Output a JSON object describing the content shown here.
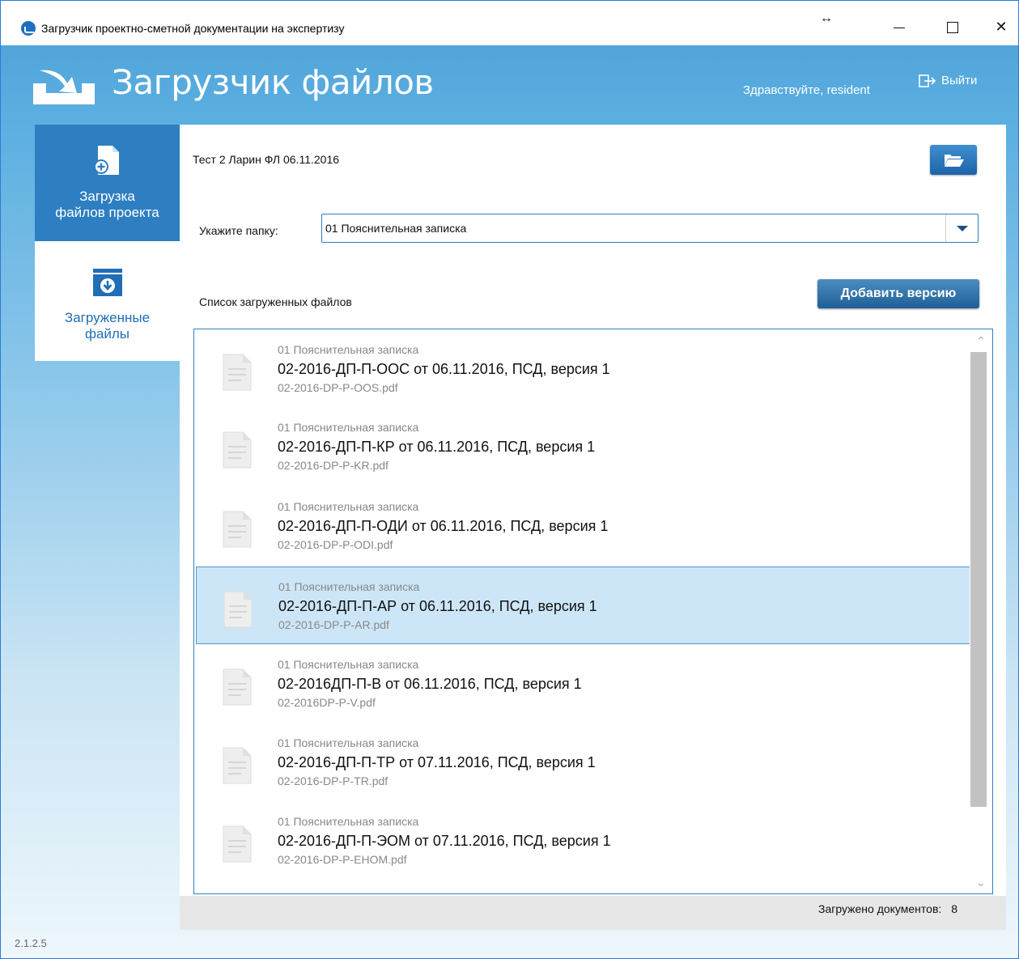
{
  "window": {
    "title": "Загрузчик проектно-сметной документации на экспертизу",
    "resize_glyph": "↔",
    "close_glyph": "✕"
  },
  "header": {
    "app_title": "Загрузчик файлов",
    "greeting": "Здравствуйте, resident",
    "logout_label": "Выйти"
  },
  "sidebar": {
    "items": [
      {
        "label": "Загрузка\nфайлов проекта",
        "icon": "file-add-icon",
        "active": true
      },
      {
        "label": "Загруженные\nфайлы",
        "icon": "folder-download-icon",
        "active": false
      }
    ]
  },
  "main": {
    "project_name": "Тест 2 Ларин ФЛ 06.11.2016",
    "folder_label": "Укажите папку:",
    "folder_selected": "01 Пояснительная записка",
    "list_title": "Список загруженных файлов",
    "add_version_label": "Добавить версию",
    "files": [
      {
        "folder": "01 Пояснительная записка",
        "title": "02-2016-ДП-П-ООС от 06.11.2016, ПСД, версия 1",
        "file": "02-2016-DP-P-OOS.pdf"
      },
      {
        "folder": "01 Пояснительная записка",
        "title": "02-2016-ДП-П-КР от 06.11.2016, ПСД, версия 1",
        "file": "02-2016-DP-P-KR.pdf"
      },
      {
        "folder": "01 Пояснительная записка",
        "title": "02-2016-ДП-П-ОДИ от 06.11.2016, ПСД, версия 1",
        "file": "02-2016-DP-P-ODI.pdf"
      },
      {
        "folder": "01 Пояснительная записка",
        "title": "02-2016-ДП-П-АР от 06.11.2016, ПСД, версия 1",
        "file": "02-2016-DP-P-AR.pdf"
      },
      {
        "folder": "01 Пояснительная записка",
        "title": "02-2016ДП-П-В от 06.11.2016, ПСД, версия 1",
        "file": "02-2016DP-P-V.pdf"
      },
      {
        "folder": "01 Пояснительная записка",
        "title": "02-2016-ДП-П-ТР от 07.11.2016, ПСД, версия 1",
        "file": "02-2016-DP-P-TR.pdf"
      },
      {
        "folder": "01 Пояснительная записка",
        "title": "02-2016-ДП-П-ЭОМ от 07.11.2016, ПСД, версия 1",
        "file": "02-2016-DP-P-EHOM.pdf"
      }
    ],
    "selected_index": 3,
    "count_label": "Загружено документов:",
    "count_value": "8"
  },
  "footer": {
    "version": "2.1.2.5"
  },
  "colors": {
    "accent": "#2e7fc1",
    "selected_row": "#cde6f7"
  }
}
